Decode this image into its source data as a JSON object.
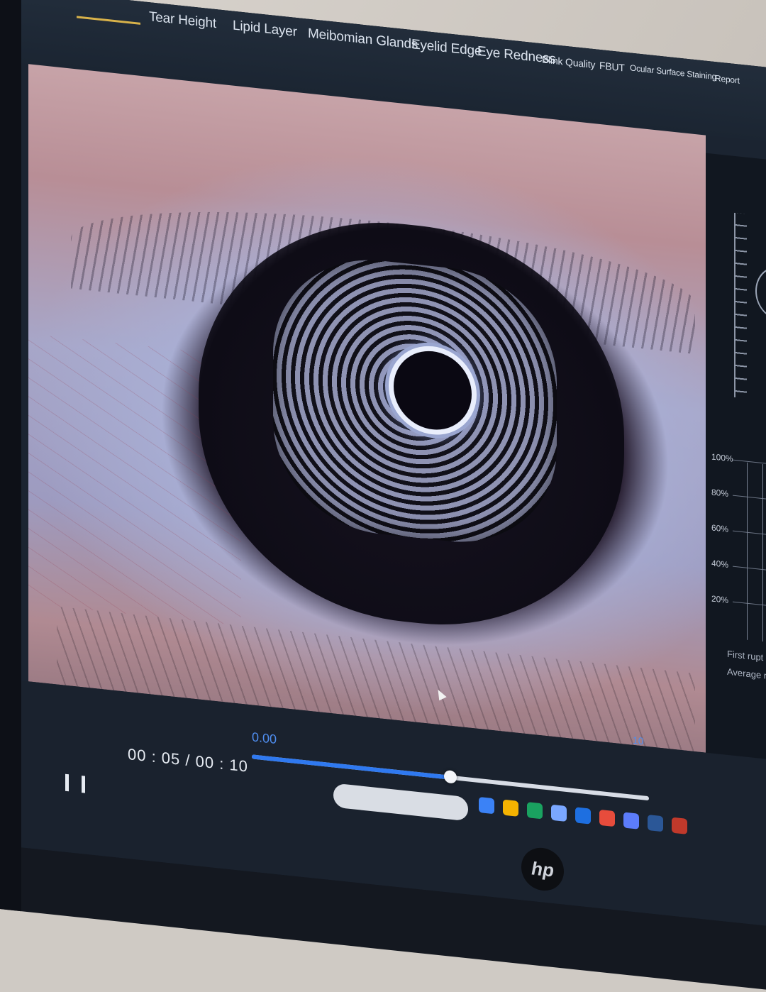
{
  "tabs": [
    {
      "label": "Tear Height",
      "active": false
    },
    {
      "label": "Lipid Layer",
      "active": false
    },
    {
      "label": "Meibomian Glands",
      "active": false
    },
    {
      "label": "Eyelid Edge",
      "active": false
    },
    {
      "label": "Eye Redness",
      "active": false
    },
    {
      "label": "Blink Quality",
      "active": false
    },
    {
      "label": "FBUT",
      "active": false
    },
    {
      "label": "Ocular Surface Staining",
      "active": false
    },
    {
      "label": "Report",
      "active": false
    }
  ],
  "player": {
    "time": "00 : 05 / 00 : 10",
    "range_start": "0.00",
    "range_end": "10",
    "progress": 0.5
  },
  "right_panel": {
    "y_ticks": [
      "100%",
      "80%",
      "60%",
      "40%",
      "20%"
    ],
    "legend": [
      "First rupt",
      "Average ru"
    ]
  },
  "taskbar_icons": [
    "file-explorer-icon",
    "edge-icon",
    "camera-icon",
    "hp-icon",
    "chrome-icon",
    "mail-icon",
    "settings-icon",
    "word-icon",
    "app-icon"
  ],
  "colors": {
    "accent": "#2f79f0",
    "active_tab": "#e7c25a"
  },
  "brand": "hp"
}
